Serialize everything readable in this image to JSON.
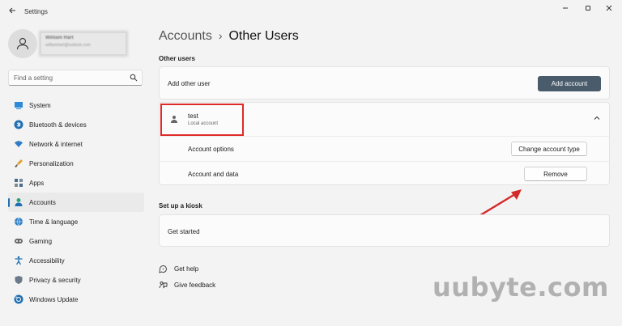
{
  "window": {
    "title": "Settings",
    "controls": [
      "minimize",
      "maximize",
      "close"
    ]
  },
  "profile": {
    "name": "William Hart",
    "email": "williamhart@outlook.com"
  },
  "search": {
    "placeholder": "Find a setting"
  },
  "sidebar": {
    "items": [
      {
        "label": "System",
        "icon": "system-icon",
        "color": "#2e8ad8"
      },
      {
        "label": "Bluetooth & devices",
        "icon": "bluetooth-icon",
        "color": "#1f6fb3"
      },
      {
        "label": "Network & internet",
        "icon": "wifi-icon",
        "color": "#2e7cc2"
      },
      {
        "label": "Personalization",
        "icon": "brush-icon",
        "color": "#d98a2a"
      },
      {
        "label": "Apps",
        "icon": "apps-icon",
        "color": "#4a6b8a"
      },
      {
        "label": "Accounts",
        "icon": "accounts-icon",
        "color": "#2aa37c",
        "active": true
      },
      {
        "label": "Time & language",
        "icon": "globe-icon",
        "color": "#2e7cc2"
      },
      {
        "label": "Gaming",
        "icon": "gamepad-icon",
        "color": "#6b6b6b"
      },
      {
        "label": "Accessibility",
        "icon": "accessibility-icon",
        "color": "#1f6fb3"
      },
      {
        "label": "Privacy & security",
        "icon": "shield-icon",
        "color": "#6b7a8a"
      },
      {
        "label": "Windows Update",
        "icon": "update-icon",
        "color": "#1f6fb3"
      }
    ]
  },
  "header": {
    "parent": "Accounts",
    "separator": "›",
    "current": "Other Users"
  },
  "other_users": {
    "section_label": "Other users",
    "add_label": "Add other user",
    "add_button": "Add account",
    "user": {
      "name": "test",
      "type": "Local account",
      "options_label": "Account options",
      "change_type_button": "Change account type",
      "data_label": "Account and data",
      "remove_button": "Remove"
    }
  },
  "kiosk": {
    "section_label": "Set up a kiosk",
    "get_started": "Get started"
  },
  "links": {
    "help": "Get help",
    "feedback": "Give feedback"
  },
  "watermark": "uubyte.com",
  "colors": {
    "accent": "#1f6fb3",
    "primary_button": "#4a5c6c",
    "highlight": "#e02a2a",
    "arrow": "#d42a2a"
  }
}
